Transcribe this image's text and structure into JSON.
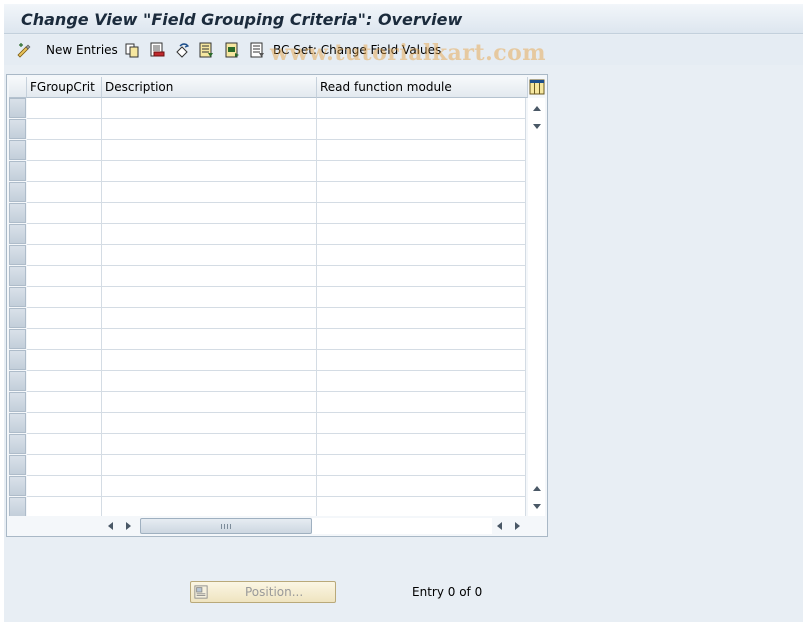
{
  "window": {
    "title": "Change View \"Field Grouping Criteria\": Overview"
  },
  "toolbar": {
    "items": [
      {
        "icon": "change-display-icon",
        "label": ""
      },
      {
        "icon": "new-entries-label",
        "label": "New Entries"
      },
      {
        "icon": "copy-as-icon",
        "label": ""
      },
      {
        "icon": "delete-icon",
        "label": ""
      },
      {
        "icon": "undo-change-icon",
        "label": ""
      },
      {
        "icon": "select-all-icon",
        "label": ""
      },
      {
        "icon": "select-block-icon",
        "label": ""
      },
      {
        "icon": "deselect-all-icon",
        "label": ""
      }
    ],
    "bc_set_label": "BC Set: Change Field Values"
  },
  "watermark": "www.tutorialkart.com",
  "table": {
    "columns": [
      "FGroupCrit",
      "Description",
      "Read function module"
    ],
    "row_count": 20,
    "rows": []
  },
  "footer": {
    "position_button": "Position...",
    "entry_text": "Entry 0 of 0"
  },
  "colors": {
    "background": "#e8eef4",
    "title": "#1b2b3c",
    "watermark": "#e6a03c"
  }
}
